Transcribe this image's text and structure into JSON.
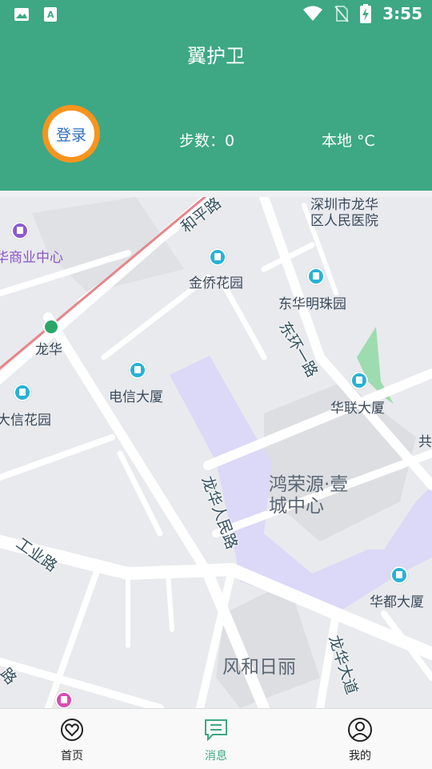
{
  "status_bar": {
    "time": "3:55",
    "icons": [
      "image-icon",
      "a-icon",
      "wifi-icon",
      "no-sim-icon",
      "battery-charging-icon"
    ]
  },
  "header": {
    "title": "翼护卫",
    "login_label": "登录",
    "steps": "步数：0",
    "weather": "本地  °C"
  },
  "map": {
    "pois": [
      "深圳市龙华区人民医院",
      "华商业中心",
      "金侨花园",
      "东华明珠园",
      "龙华",
      "电信大厦",
      "华联大厦",
      "大信花园",
      "鸿荣源·壹城中心",
      "华都大厦",
      "风和日丽",
      "共"
    ],
    "roads": [
      "和平路",
      "东环一路",
      "龙华人民路",
      "工业路",
      "龙华大道",
      "路"
    ]
  },
  "tabbar": {
    "tabs": [
      {
        "label": "首页",
        "icon": "heart-icon",
        "active": false
      },
      {
        "label": "消息",
        "icon": "message-icon",
        "active": true
      },
      {
        "label": "我的",
        "icon": "user-icon",
        "active": false
      }
    ]
  },
  "colors": {
    "header_bg": "#3da883",
    "login_ring": "#f7941d",
    "login_text": "#2f6fbf",
    "active_tab": "#3da883"
  }
}
